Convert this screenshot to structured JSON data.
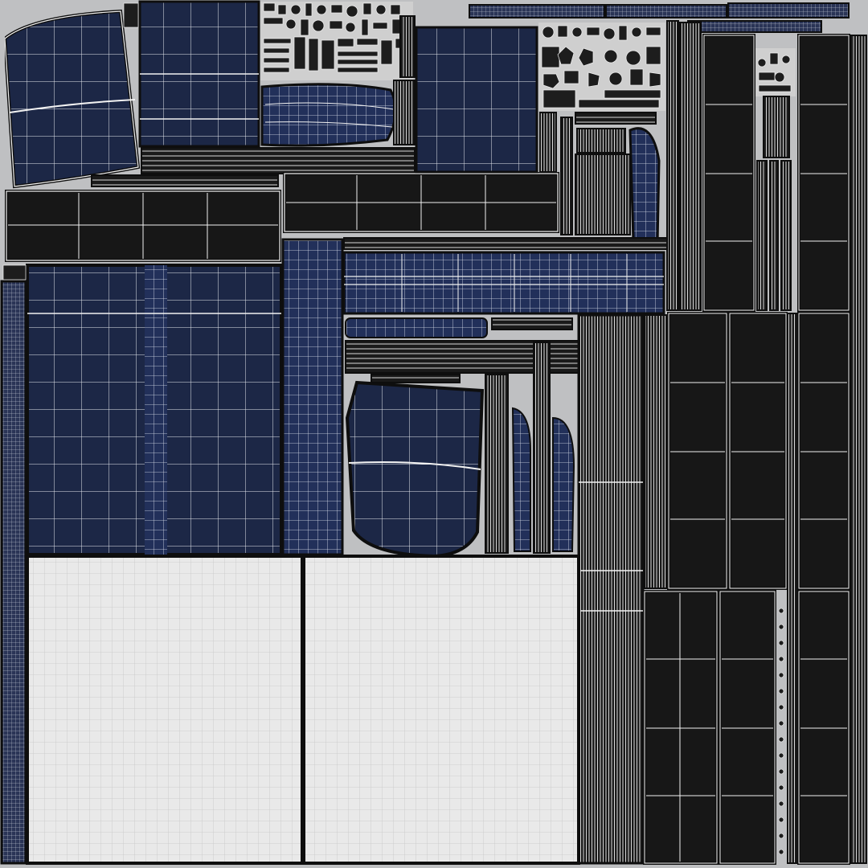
{
  "colors": {
    "background": "#bfc0c2",
    "navy_fill": "#1c2746",
    "navy_fill_alt": "#22305a",
    "dark_fill": "#171717",
    "light_fill": "#e9e9e9",
    "wire": "#f2f2f2",
    "outline": "#0e0e0e",
    "light_grid": "#c9c9c9"
  },
  "uv_islands": {
    "navy_panels": 11,
    "dark_panels": 15,
    "light_panels": 2,
    "strip_columns": 8,
    "small_pieces": 60
  }
}
